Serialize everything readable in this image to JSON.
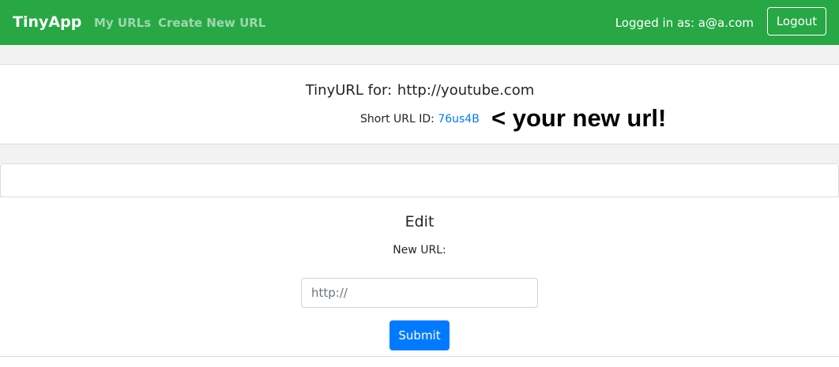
{
  "navbar": {
    "brand": "TinyApp",
    "links": [
      {
        "label": "My URLs"
      },
      {
        "label": "Create New URL"
      }
    ],
    "logged_in_text": "Logged in as: a@a.com",
    "logout_label": "Logout",
    "bg_color": "#28a745"
  },
  "url_info": {
    "title_prefix": "TinyURL for:",
    "long_url": "http://youtube.com",
    "short_label": "Short URL ID:",
    "short_id": "76us4B",
    "note": "< your new url!"
  },
  "edit": {
    "title": "Edit",
    "new_url_label": "New URL:",
    "input_placeholder": "http://",
    "input_value": "",
    "submit_label": "Submit",
    "submit_color": "#007bff"
  }
}
